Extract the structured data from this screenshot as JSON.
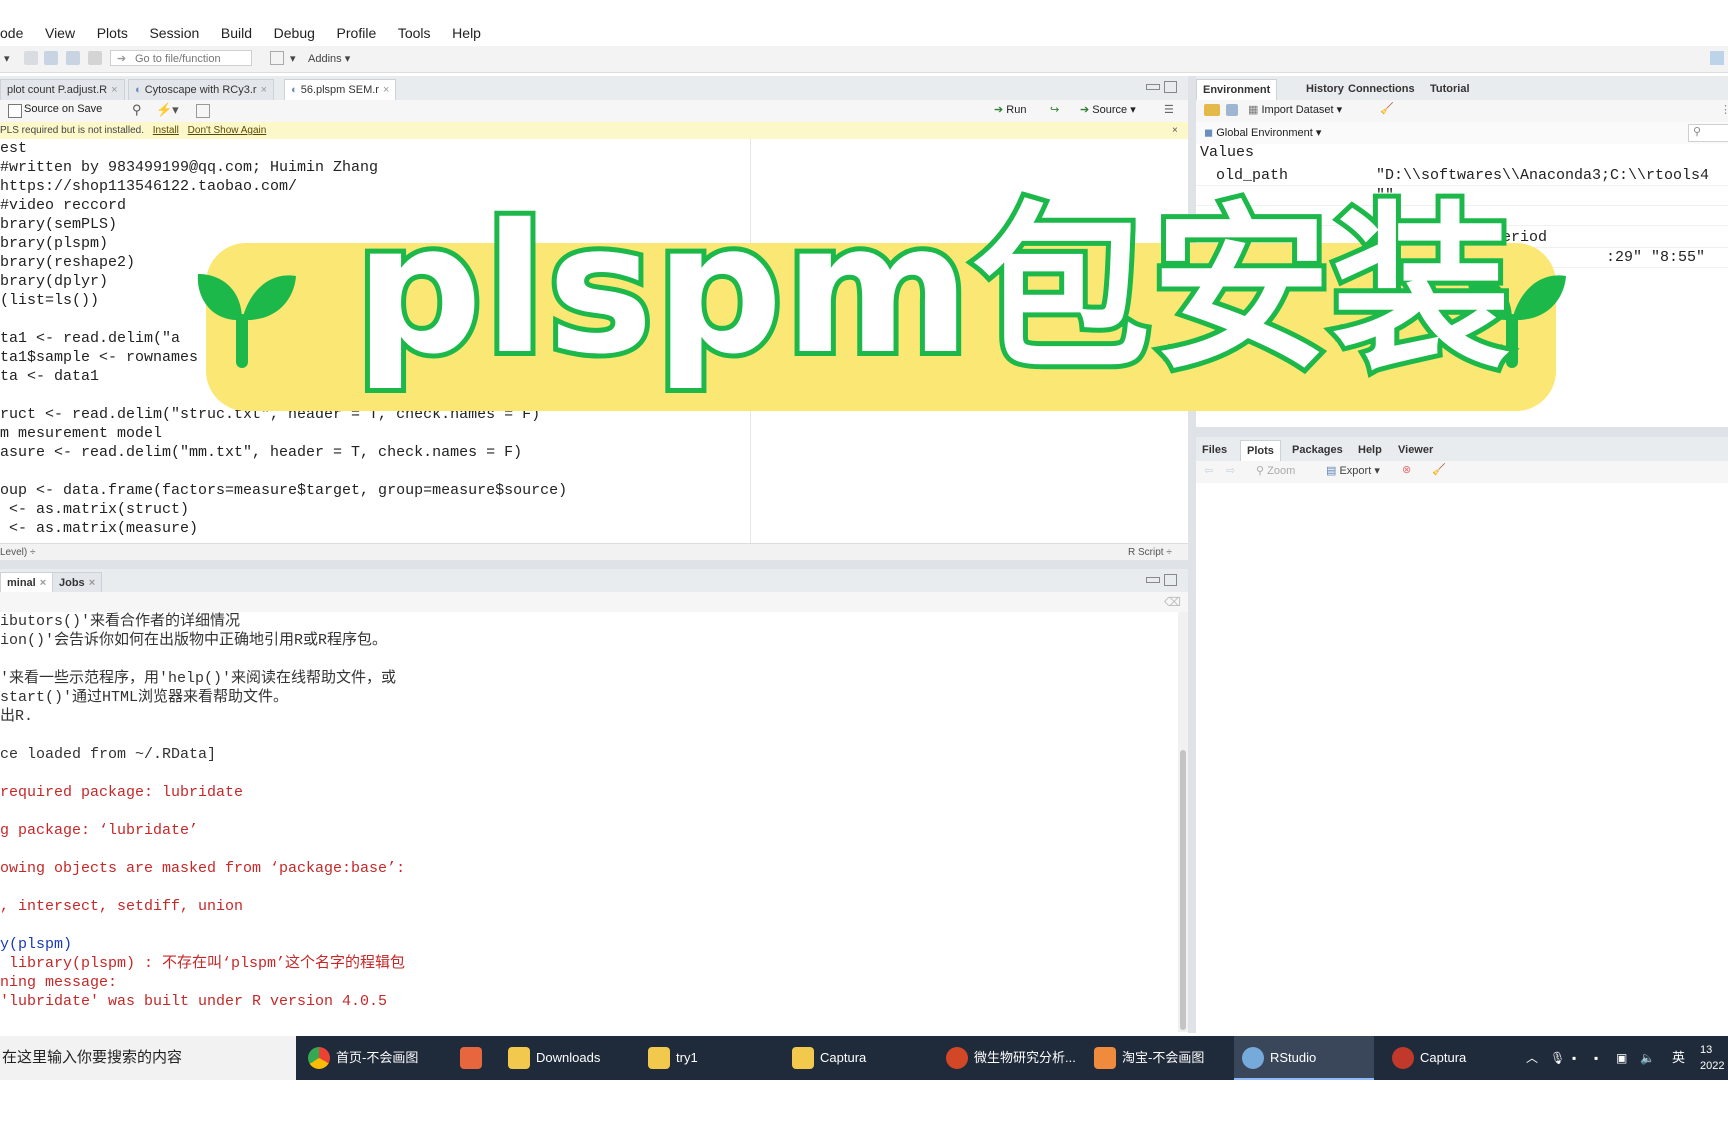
{
  "menu": [
    "ode",
    "View",
    "Plots",
    "Session",
    "Build",
    "Debug",
    "Profile",
    "Tools",
    "Help"
  ],
  "toolbar": {
    "goto_placeholder": "Go to file/function",
    "addins": "Addins"
  },
  "editor": {
    "tabs": [
      {
        "label": "plot count P.adjust.R"
      },
      {
        "label": "Cytoscape with RCy3.r"
      },
      {
        "label": "56.plspm SEM.r"
      }
    ],
    "source_on_save": "Source on Save",
    "run": "Run",
    "source": "Source",
    "infobar": {
      "message": "PLS required but is not installed.",
      "install": "Install",
      "dont_show": "Don't Show Again"
    },
    "lines": [
      "est",
      "#written by 983499199@qq.com; Huimin Zhang",
      "https://shop113546122.taobao.com/",
      "#video reccord",
      "brary(semPLS)",
      "brary(plspm)",
      "brary(reshape2)",
      "brary(dplyr)",
      "(list=ls())",
      "",
      "ta1 <- read.delim(\"a",
      "ta1$sample <- rownames",
      "ta <- data1",
      "",
      "ruct <- read.delim(\"struc.txt\", header = T, check.names = F)",
      "m mesurement model",
      "asure <- read.delim(\"mm.txt\", header = T, check.names = F)",
      "",
      "oup <- data.frame(factors=measure$target, group=measure$source)",
      " <- as.matrix(struct)",
      " <- as.matrix(measure)"
    ],
    "status_left": "Level) ÷",
    "status_right": "R Script ÷"
  },
  "console": {
    "tabs": [
      {
        "label": "minal"
      },
      {
        "label": "Jobs"
      }
    ],
    "lines": [
      {
        "text": "ibutors()'来看合作者的详细情况",
        "color": "dark"
      },
      {
        "text": "ion()'会告诉你如何在出版物中正确地引用R或R程序包。",
        "color": "dark"
      },
      {
        "text": "",
        "color": "dark"
      },
      {
        "text": "'来看一些示范程序，用'help()'来阅读在线帮助文件，或",
        "color": "dark"
      },
      {
        "text": "start()'通过HTML浏览器来看帮助文件。",
        "color": "dark"
      },
      {
        "text": "出R.",
        "color": "dark"
      },
      {
        "text": "",
        "color": "dark"
      },
      {
        "text": "ce loaded from ~/.RData]",
        "color": "dark"
      },
      {
        "text": "",
        "color": "dark"
      },
      {
        "text": "required package: lubridate",
        "color": "red"
      },
      {
        "text": "",
        "color": "dark"
      },
      {
        "text": "g package: ‘lubridate’",
        "color": "red"
      },
      {
        "text": "",
        "color": "dark"
      },
      {
        "text": "owing objects are masked from ‘package:base’:",
        "color": "red"
      },
      {
        "text": "",
        "color": "dark"
      },
      {
        "text": ", intersect, setdiff, union",
        "color": "red"
      },
      {
        "text": "",
        "color": "dark"
      },
      {
        "text": "y(plspm)",
        "color": "blue"
      },
      {
        "text": " library(plspm) : 不存在叫‘plspm’这个名字的程辑包",
        "color": "red"
      },
      {
        "text": "ning message:",
        "color": "red"
      },
      {
        "text": "'lubridate' was built under R version 4.0.5",
        "color": "red"
      }
    ]
  },
  "environment": {
    "tabs": [
      {
        "label": "Environment"
      },
      {
        "label": "History"
      },
      {
        "label": "Connections"
      },
      {
        "label": "Tutorial"
      }
    ],
    "import_dataset": "Import Dataset",
    "scope": "Global Environment",
    "section": "Values",
    "rows": [
      {
        "name": "old_path",
        "value": "\"D:\\\\softwares\\\\Anaconda3;C:\\\\rtools4"
      },
      {
        "name": "",
        "value": "\"\""
      },
      {
        "name": "",
        "value": "\"\""
      },
      {
        "name": "",
        "value": "Formal class Period"
      },
      {
        "name": "",
        "value": ":29\" \"8:55\""
      }
    ]
  },
  "files": {
    "tabs": [
      {
        "label": "Files"
      },
      {
        "label": "Plots"
      },
      {
        "label": "Packages"
      },
      {
        "label": "Help"
      },
      {
        "label": "Viewer"
      }
    ],
    "zoom": "Zoom",
    "export": "Export"
  },
  "banner": {
    "title": "plspm包安装",
    "bg_color": "#fbe774",
    "stroke_color": "#1cb84a"
  },
  "taskbar": {
    "search_placeholder": "在这里输入你要搜索的内容",
    "items": [
      {
        "label": "首页-不会画图请...",
        "icon": "chrome-icon"
      },
      {
        "label": "",
        "icon": "app-icon"
      },
      {
        "label": "Downloads",
        "icon": "folder-icon"
      },
      {
        "label": "try1",
        "icon": "folder-icon"
      },
      {
        "label": "Captura",
        "icon": "folder-icon"
      },
      {
        "label": "微生物研究分析...",
        "icon": "powerpoint-icon"
      },
      {
        "label": "淘宝-不会画图请...",
        "icon": "browser-icon"
      },
      {
        "label": "RStudio",
        "icon": "rstudio-icon"
      },
      {
        "label": "Captura",
        "icon": "captura-icon"
      }
    ],
    "ime": "英",
    "clock_time": "13",
    "clock_date": "2022"
  }
}
